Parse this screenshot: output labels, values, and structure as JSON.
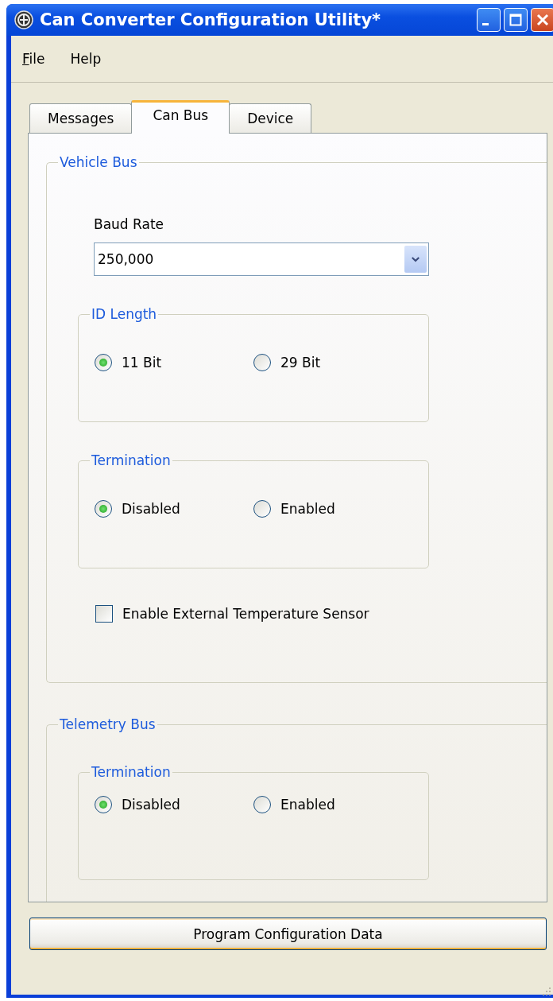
{
  "window": {
    "title": "Can Converter Configuration Utility*"
  },
  "menu": [
    {
      "label": "File",
      "mnemonic_underlined": true
    },
    {
      "label": "Help",
      "mnemonic_underlined": false
    }
  ],
  "tabs": [
    {
      "label": "Messages",
      "selected": false
    },
    {
      "label": "Can Bus",
      "selected": true
    },
    {
      "label": "Device",
      "selected": false
    }
  ],
  "vehicle_bus": {
    "title": "Vehicle Bus",
    "baud_rate": {
      "label": "Baud Rate",
      "value": "250,000"
    },
    "id_length": {
      "title": "ID Length",
      "options": [
        {
          "label": "11 Bit",
          "selected": true
        },
        {
          "label": "29 Bit",
          "selected": false
        }
      ]
    },
    "termination": {
      "title": "Termination",
      "options": [
        {
          "label": "Disabled",
          "selected": true
        },
        {
          "label": "Enabled",
          "selected": false
        }
      ]
    },
    "temperature_sensor": {
      "label": "Enable External Temperature Sensor",
      "checked": false
    }
  },
  "telemetry_bus": {
    "title": "Telemetry Bus",
    "termination": {
      "title": "Termination",
      "options": [
        {
          "label": "Disabled",
          "selected": true
        },
        {
          "label": "Enabled",
          "selected": false
        }
      ]
    }
  },
  "program_button": {
    "label": "Program Configuration Data"
  }
}
